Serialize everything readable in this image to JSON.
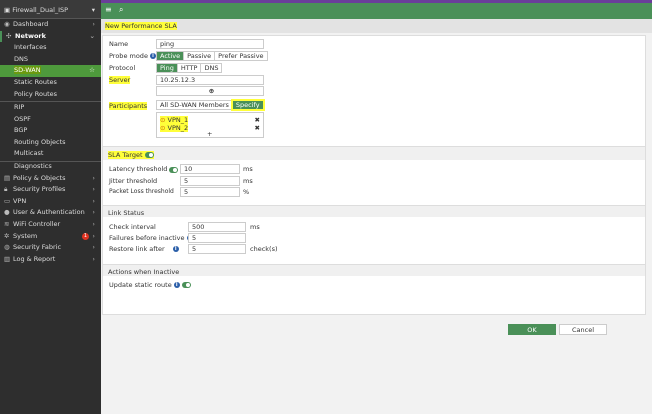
{
  "sidebar": {
    "device": "Firewall_Dual_ISP",
    "items": [
      {
        "label": "Dashboard"
      },
      {
        "label": "Network"
      },
      {
        "label": "Interfaces"
      },
      {
        "label": "DNS"
      },
      {
        "label": "SD-WAN"
      },
      {
        "label": "Static Routes"
      },
      {
        "label": "Policy Routes"
      },
      {
        "label": "RIP"
      },
      {
        "label": "OSPF"
      },
      {
        "label": "BGP"
      },
      {
        "label": "Routing Objects"
      },
      {
        "label": "Multicast"
      },
      {
        "label": "Diagnostics"
      },
      {
        "label": "Policy & Objects"
      },
      {
        "label": "Security Profiles"
      },
      {
        "label": "VPN"
      },
      {
        "label": "User & Authentication"
      },
      {
        "label": "WiFi Controller"
      },
      {
        "label": "System",
        "badge": "1"
      },
      {
        "label": "Security Fabric"
      },
      {
        "label": "Log & Report"
      }
    ]
  },
  "page_title": "New Performance SLA",
  "form": {
    "name_label": "Name",
    "name_value": "ping",
    "probe_label": "Probe mode",
    "probe_options": [
      "Active",
      "Passive",
      "Prefer Passive"
    ],
    "protocol_label": "Protocol",
    "protocol_options": [
      "Ping",
      "HTTP",
      "DNS"
    ],
    "server_label": "Server",
    "server_value": "10.25.12.3",
    "participants_label": "Participants",
    "participants_options": [
      "All SD-WAN Members",
      "Specify"
    ],
    "members": [
      "VPN_1",
      "VPN_2"
    ],
    "sla_label": "SLA Target",
    "latency_label": "Latency threshold",
    "latency_value": "10",
    "latency_unit": "ms",
    "jitter_label": "Jitter threshold",
    "jitter_value": "5",
    "jitter_unit": "ms",
    "loss_label": "Packet Loss threshold",
    "loss_value": "5",
    "loss_unit": "%",
    "link_status_label": "Link Status",
    "check_label": "Check interval",
    "check_value": "500",
    "check_unit": "ms",
    "fail_label": "Failures before inactive",
    "fail_value": "5",
    "restore_label": "Restore link after",
    "restore_value": "5",
    "restore_unit": "check(s)",
    "actions_label": "Actions when Inactive",
    "update_label": "Update static route"
  },
  "buttons": {
    "ok": "OK",
    "cancel": "Cancel"
  }
}
